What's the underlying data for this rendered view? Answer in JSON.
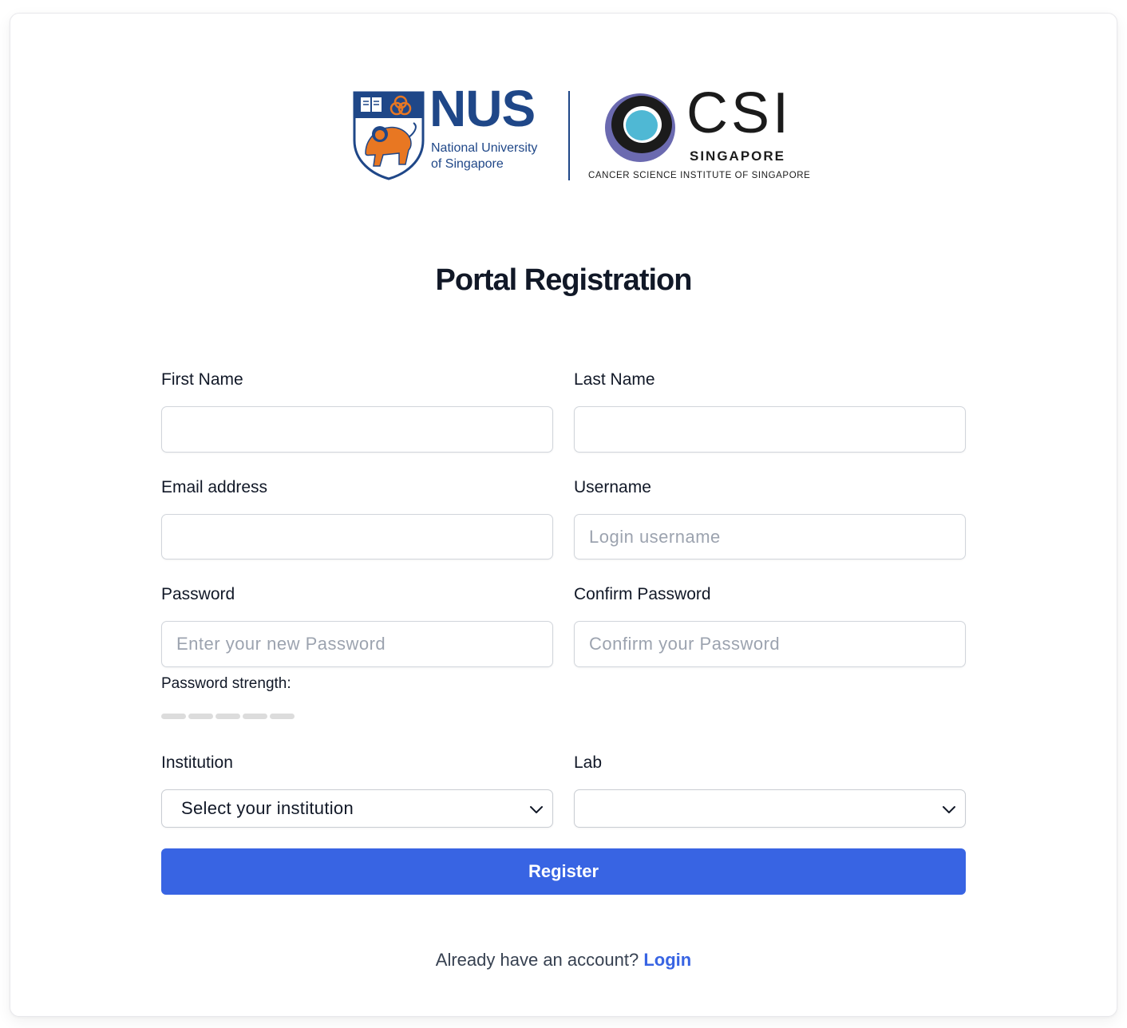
{
  "logos": {
    "nus": {
      "wordmark": "NUS",
      "line1": "National University",
      "line2": "of Singapore"
    },
    "csi": {
      "wordmark": "CSI",
      "subtitle": "SINGAPORE",
      "full_name": "CANCER SCIENCE INSTITUTE OF SINGAPORE"
    }
  },
  "page_title": "Portal Registration",
  "form": {
    "first_name": {
      "label": "First Name",
      "value": "",
      "placeholder": ""
    },
    "last_name": {
      "label": "Last Name",
      "value": "",
      "placeholder": ""
    },
    "email": {
      "label": "Email address",
      "value": "",
      "placeholder": ""
    },
    "username": {
      "label": "Username",
      "value": "",
      "placeholder": "Login username"
    },
    "password": {
      "label": "Password",
      "value": "",
      "placeholder": "Enter your new Password"
    },
    "confirm_password": {
      "label": "Confirm Password",
      "value": "",
      "placeholder": "Confirm your Password"
    },
    "password_strength": {
      "label": "Password strength:",
      "level": 0,
      "segments": 5
    },
    "institution": {
      "label": "Institution",
      "selected": "Select your institution"
    },
    "lab": {
      "label": "Lab",
      "selected": ""
    },
    "register_label": "Register"
  },
  "footer": {
    "prompt": "Already have an account?",
    "login_link": "Login"
  },
  "colors": {
    "accent": "#3864e3",
    "nus_blue": "#1f4788",
    "nus_orange": "#e87722",
    "csi_purple": "#6b6ab0",
    "csi_cyan": "#4fb8d4"
  }
}
